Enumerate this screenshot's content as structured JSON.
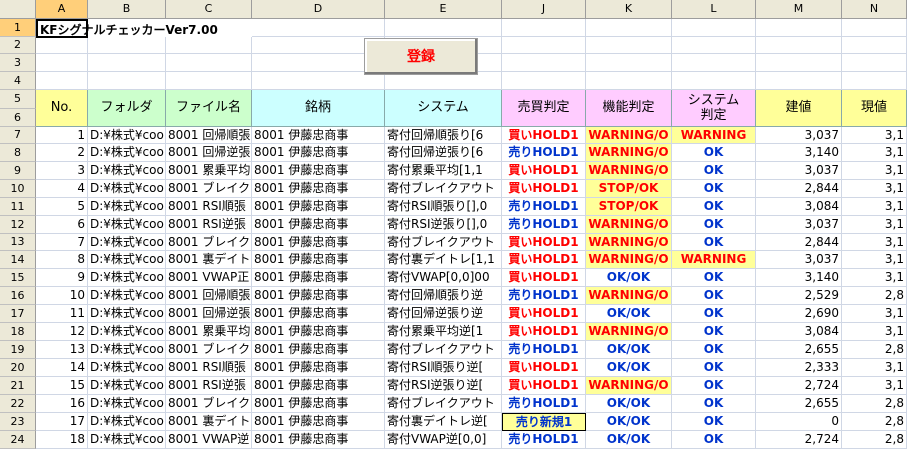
{
  "cell_a1": "KFシグナルチェッカーVer7.00",
  "register_button": "登録",
  "columns": [
    "A",
    "B",
    "C",
    "D",
    "E",
    "J",
    "K",
    "L",
    "M",
    "N"
  ],
  "row_numbers": [
    "1",
    "2",
    "3",
    "4",
    "5",
    "6",
    "7",
    "8",
    "9",
    "10",
    "11",
    "12",
    "13",
    "14",
    "15",
    "16",
    "17",
    "18",
    "19",
    "20",
    "21",
    "22",
    "23",
    "24"
  ],
  "headers": {
    "no": "No.",
    "folder": "フォルダ",
    "filename": "ファイル名",
    "stock": "銘柄",
    "system": "システム",
    "trade": "売買判定",
    "func": "機能判定",
    "sys_judge": "システム\n判定",
    "entry": "建値",
    "current": "現値"
  },
  "colors": {
    "header_yellow": "#ffff99",
    "header_green": "#ccffcc",
    "header_cyan": "#ccffff",
    "header_pink": "#ffccff",
    "sell_blue": "#0033cc",
    "buy_red": "#ff0000",
    "warn_bg": "#ffff99"
  },
  "rows": [
    {
      "no": "1",
      "folder": "D:¥株式¥coo",
      "file": "8001 回帰順張",
      "stock": "8001 伊藤忠商事",
      "system": "寄付回帰順張り[6",
      "trade": "買いHOLD1",
      "trade_type": "buy",
      "func": "WARNING/O",
      "func_warn": true,
      "sj": "WARNING",
      "sj_warn": true,
      "entry": "3,037",
      "current": "3,1"
    },
    {
      "no": "2",
      "folder": "D:¥株式¥coo",
      "file": "8001 回帰逆張",
      "stock": "8001 伊藤忠商事",
      "system": "寄付回帰逆張り[6",
      "trade": "売りHOLD1",
      "trade_type": "sell",
      "func": "WARNING/O",
      "func_warn": true,
      "sj": "OK",
      "sj_warn": false,
      "entry": "3,140",
      "current": "3,1"
    },
    {
      "no": "3",
      "folder": "D:¥株式¥coo",
      "file": "8001 累乗平均",
      "stock": "8001 伊藤忠商事",
      "system": "寄付累乗平均[1,1",
      "trade": "買いHOLD1",
      "trade_type": "buy",
      "func": "WARNING/O",
      "func_warn": true,
      "sj": "OK",
      "sj_warn": false,
      "entry": "3,037",
      "current": "3,1"
    },
    {
      "no": "4",
      "folder": "D:¥株式¥coo",
      "file": "8001 ブレイクア",
      "stock": "8001 伊藤忠商事",
      "system": "寄付ブレイクアウト",
      "trade": "買いHOLD1",
      "trade_type": "buy",
      "func": "STOP/OK",
      "func_warn": true,
      "sj": "OK",
      "sj_warn": false,
      "entry": "2,844",
      "current": "3,1"
    },
    {
      "no": "5",
      "folder": "D:¥株式¥coo",
      "file": "8001 RSI順張",
      "stock": "8001 伊藤忠商事",
      "system": "寄付RSI順張り[],0",
      "trade": "売りHOLD1",
      "trade_type": "sell",
      "func": "STOP/OK",
      "func_warn": true,
      "sj": "OK",
      "sj_warn": false,
      "entry": "3,084",
      "current": "3,1"
    },
    {
      "no": "6",
      "folder": "D:¥株式¥coo",
      "file": "8001 RSI逆張",
      "stock": "8001 伊藤忠商事",
      "system": "寄付RSI逆張り[],0",
      "trade": "売りHOLD1",
      "trade_type": "sell",
      "func": "WARNING/O",
      "func_warn": true,
      "sj": "OK",
      "sj_warn": false,
      "entry": "3,037",
      "current": "3,1"
    },
    {
      "no": "7",
      "folder": "D:¥株式¥coo",
      "file": "8001 ブレイクア",
      "stock": "8001 伊藤忠商事",
      "system": "寄付ブレイクアウト",
      "trade": "買いHOLD1",
      "trade_type": "buy",
      "func": "WARNING/O",
      "func_warn": true,
      "sj": "OK",
      "sj_warn": false,
      "entry": "2,844",
      "current": "3,1"
    },
    {
      "no": "8",
      "folder": "D:¥株式¥coo",
      "file": "8001 裏デイト",
      "stock": "8001 伊藤忠商事",
      "system": "寄付裏デイトレ[1,1",
      "trade": "買いHOLD1",
      "trade_type": "buy",
      "func": "WARNING/O",
      "func_warn": true,
      "sj": "WARNING",
      "sj_warn": true,
      "entry": "3,037",
      "current": "3,1"
    },
    {
      "no": "9",
      "folder": "D:¥株式¥coo",
      "file": "8001 VWAP正",
      "stock": "8001 伊藤忠商事",
      "system": "寄付VWAP[0,0]00",
      "trade": "買いHOLD1",
      "trade_type": "buy",
      "func": "OK/OK",
      "func_warn": false,
      "sj": "OK",
      "sj_warn": false,
      "entry": "3,140",
      "current": "3,1"
    },
    {
      "no": "10",
      "folder": "D:¥株式¥coo",
      "file": "8001 回帰順張",
      "stock": "8001 伊藤忠商事",
      "system": "寄付回帰順張り逆",
      "trade": "売りHOLD1",
      "trade_type": "sell",
      "func": "WARNING/O",
      "func_warn": true,
      "sj": "OK",
      "sj_warn": false,
      "entry": "2,529",
      "current": "2,8"
    },
    {
      "no": "11",
      "folder": "D:¥株式¥coo",
      "file": "8001 回帰逆張",
      "stock": "8001 伊藤忠商事",
      "system": "寄付回帰逆張り逆",
      "trade": "買いHOLD1",
      "trade_type": "buy",
      "func": "OK/OK",
      "func_warn": false,
      "sj": "OK",
      "sj_warn": false,
      "entry": "2,690",
      "current": "3,1"
    },
    {
      "no": "12",
      "folder": "D:¥株式¥coo",
      "file": "8001 累乗平均",
      "stock": "8001 伊藤忠商事",
      "system": "寄付累乗平均逆[1",
      "trade": "買いHOLD1",
      "trade_type": "buy",
      "func": "WARNING/O",
      "func_warn": true,
      "sj": "OK",
      "sj_warn": false,
      "entry": "3,084",
      "current": "3,1"
    },
    {
      "no": "13",
      "folder": "D:¥株式¥coo",
      "file": "8001 ブレイクア",
      "stock": "8001 伊藤忠商事",
      "system": "寄付ブレイクアウト",
      "trade": "売りHOLD1",
      "trade_type": "sell",
      "func": "OK/OK",
      "func_warn": false,
      "sj": "OK",
      "sj_warn": false,
      "entry": "2,655",
      "current": "2,8"
    },
    {
      "no": "14",
      "folder": "D:¥株式¥coo",
      "file": "8001 RSI順張",
      "stock": "8001 伊藤忠商事",
      "system": "寄付RSI順張り逆[",
      "trade": "買いHOLD1",
      "trade_type": "buy",
      "func": "OK/OK",
      "func_warn": false,
      "sj": "OK",
      "sj_warn": false,
      "entry": "2,333",
      "current": "3,1"
    },
    {
      "no": "15",
      "folder": "D:¥株式¥coo",
      "file": "8001 RSI逆張",
      "stock": "8001 伊藤忠商事",
      "system": "寄付RSI逆張り逆[",
      "trade": "買いHOLD1",
      "trade_type": "buy",
      "func": "WARNING/O",
      "func_warn": true,
      "sj": "OK",
      "sj_warn": false,
      "entry": "2,724",
      "current": "3,1"
    },
    {
      "no": "16",
      "folder": "D:¥株式¥coo",
      "file": "8001 ブレイクア",
      "stock": "8001 伊藤忠商事",
      "system": "寄付ブレイクアウト",
      "trade": "売りHOLD1",
      "trade_type": "sell",
      "func": "OK/OK",
      "func_warn": false,
      "sj": "OK",
      "sj_warn": false,
      "entry": "2,655",
      "current": "2,8"
    },
    {
      "no": "17",
      "folder": "D:¥株式¥coo",
      "file": "8001 裏デイト",
      "stock": "8001 伊藤忠商事",
      "system": "寄付裏デイトレ逆[",
      "trade": "売り新規1",
      "trade_type": "sellnew",
      "func": "OK/OK",
      "func_warn": false,
      "sj": "OK",
      "sj_warn": false,
      "entry": "0",
      "current": "2,8"
    },
    {
      "no": "18",
      "folder": "D:¥株式¥coo",
      "file": "8001 VWAP逆",
      "stock": "8001 伊藤忠商事",
      "system": "寄付VWAP逆[0,0]",
      "trade": "売りHOLD1",
      "trade_type": "sell",
      "func": "OK/OK",
      "func_warn": false,
      "sj": "OK",
      "sj_warn": false,
      "entry": "2,724",
      "current": "2,8"
    }
  ]
}
